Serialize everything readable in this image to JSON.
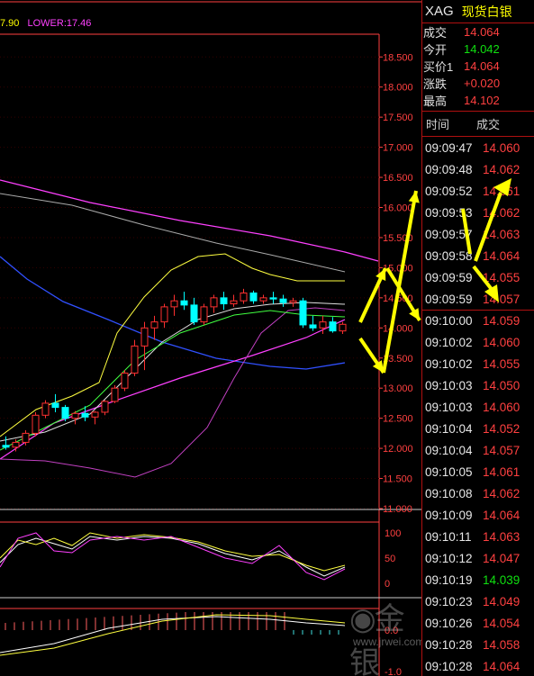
{
  "indicator": {
    "prefix": "7.90",
    "lower": "LOWER:17.46"
  },
  "symbol": {
    "code": "XAG",
    "name": "现货白银"
  },
  "quote": [
    {
      "label": "成交",
      "value": "14.064",
      "color": "red"
    },
    {
      "label": "今开",
      "value": "14.042",
      "color": "green"
    },
    {
      "label": "买价1",
      "value": "14.064",
      "color": "red"
    },
    {
      "label": "涨跌",
      "value": "+0.020",
      "color": "red"
    },
    {
      "label": "最高",
      "value": "14.102",
      "color": "red"
    }
  ],
  "tick_header": {
    "time": "时间",
    "price": "成交"
  },
  "ticks": [
    {
      "time": "09:09:47",
      "price": "14.060",
      "color": "red"
    },
    {
      "time": "09:09:48",
      "price": "14.062",
      "color": "red"
    },
    {
      "time": "09:09:52",
      "price": "14.061",
      "color": "red"
    },
    {
      "time": "09:09:53",
      "price": "14.062",
      "color": "red"
    },
    {
      "time": "09:09:57",
      "price": "14.063",
      "color": "red"
    },
    {
      "time": "09:09:58",
      "price": "14.064",
      "color": "red"
    },
    {
      "time": "09:09:59",
      "price": "14.055",
      "color": "red"
    },
    {
      "time": "09:09:59",
      "price": "14.057",
      "color": "red"
    },
    {
      "time": "09:10:00",
      "price": "14.059",
      "color": "red"
    },
    {
      "time": "09:10:02",
      "price": "14.060",
      "color": "red"
    },
    {
      "time": "09:10:02",
      "price": "14.055",
      "color": "red"
    },
    {
      "time": "09:10:03",
      "price": "14.050",
      "color": "red"
    },
    {
      "time": "09:10:03",
      "price": "14.060",
      "color": "red"
    },
    {
      "time": "09:10:04",
      "price": "14.052",
      "color": "red"
    },
    {
      "time": "09:10:04",
      "price": "14.057",
      "color": "red"
    },
    {
      "time": "09:10:05",
      "price": "14.061",
      "color": "red"
    },
    {
      "time": "09:10:08",
      "price": "14.062",
      "color": "red"
    },
    {
      "time": "09:10:09",
      "price": "14.064",
      "color": "red"
    },
    {
      "time": "09:10:11",
      "price": "14.063",
      "color": "red"
    },
    {
      "time": "09:10:12",
      "price": "14.047",
      "color": "red"
    },
    {
      "time": "09:10:19",
      "price": "14.039",
      "color": "green"
    },
    {
      "time": "09:10:23",
      "price": "14.049",
      "color": "red"
    },
    {
      "time": "09:10:26",
      "price": "14.054",
      "color": "red"
    },
    {
      "time": "09:10:28",
      "price": "14.058",
      "color": "red"
    },
    {
      "time": "09:10:28",
      "price": "14.064",
      "color": "red"
    }
  ],
  "price_axis": [
    "18.500",
    "18.000",
    "17.500",
    "17.000",
    "16.500",
    "16.000",
    "15.500",
    "15.000",
    "14.500",
    "14.000",
    "13.500",
    "13.000",
    "12.500",
    "12.000",
    "11.500",
    "11.000"
  ],
  "kdj_axis": [
    "100",
    "50",
    "0"
  ],
  "macd_axis": [
    "0.0",
    "-1.0"
  ],
  "watermark": {
    "logo": "金银圈",
    "url": "www.jrwei.com"
  },
  "colors": {
    "red": "#ff4040",
    "green": "#10e010",
    "grid": "#b01010",
    "yellow": "#ffff00",
    "magenta": "#ff40ff"
  },
  "candles": [
    {
      "o": 12.05,
      "h": 12.2,
      "l": 11.98,
      "c": 12.02
    },
    {
      "o": 12.02,
      "h": 12.15,
      "l": 11.95,
      "c": 12.1
    },
    {
      "o": 12.1,
      "h": 12.3,
      "l": 12.05,
      "c": 12.25
    },
    {
      "o": 12.25,
      "h": 12.6,
      "l": 12.2,
      "c": 12.55
    },
    {
      "o": 12.55,
      "h": 12.8,
      "l": 12.5,
      "c": 12.75
    },
    {
      "o": 12.75,
      "h": 12.9,
      "l": 12.6,
      "c": 12.68
    },
    {
      "o": 12.68,
      "h": 12.72,
      "l": 12.45,
      "c": 12.5
    },
    {
      "o": 12.5,
      "h": 12.62,
      "l": 12.4,
      "c": 12.58
    },
    {
      "o": 12.58,
      "h": 12.7,
      "l": 12.45,
      "c": 12.52
    },
    {
      "o": 12.52,
      "h": 12.62,
      "l": 12.4,
      "c": 12.6
    },
    {
      "o": 12.6,
      "h": 12.8,
      "l": 12.55,
      "c": 12.78
    },
    {
      "o": 12.78,
      "h": 13.05,
      "l": 12.75,
      "c": 13.0
    },
    {
      "o": 13.0,
      "h": 13.3,
      "l": 12.95,
      "c": 13.25
    },
    {
      "o": 13.25,
      "h": 13.8,
      "l": 13.2,
      "c": 13.7
    },
    {
      "o": 13.7,
      "h": 14.1,
      "l": 13.3,
      "c": 14.0
    },
    {
      "o": 14.0,
      "h": 14.2,
      "l": 13.8,
      "c": 14.1
    },
    {
      "o": 14.1,
      "h": 14.4,
      "l": 14.0,
      "c": 14.35
    },
    {
      "o": 14.35,
      "h": 14.55,
      "l": 14.2,
      "c": 14.45
    },
    {
      "o": 14.45,
      "h": 14.6,
      "l": 14.3,
      "c": 14.38
    },
    {
      "o": 14.38,
      "h": 14.5,
      "l": 14.05,
      "c": 14.1
    },
    {
      "o": 14.1,
      "h": 14.4,
      "l": 14.05,
      "c": 14.35
    },
    {
      "o": 14.35,
      "h": 14.55,
      "l": 14.25,
      "c": 14.5
    },
    {
      "o": 14.5,
      "h": 14.6,
      "l": 14.3,
      "c": 14.4
    },
    {
      "o": 14.4,
      "h": 14.55,
      "l": 14.35,
      "c": 14.45
    },
    {
      "o": 14.45,
      "h": 14.65,
      "l": 14.4,
      "c": 14.58
    },
    {
      "o": 14.58,
      "h": 14.62,
      "l": 14.4,
      "c": 14.45
    },
    {
      "o": 14.45,
      "h": 14.55,
      "l": 14.4,
      "c": 14.5
    },
    {
      "o": 14.5,
      "h": 14.6,
      "l": 14.4,
      "c": 14.48
    },
    {
      "o": 14.48,
      "h": 14.55,
      "l": 14.35,
      "c": 14.42
    },
    {
      "o": 14.42,
      "h": 14.5,
      "l": 14.35,
      "c": 14.45
    },
    {
      "o": 14.45,
      "h": 14.5,
      "l": 14.0,
      "c": 14.05
    },
    {
      "o": 14.05,
      "h": 14.2,
      "l": 13.95,
      "c": 14.0
    },
    {
      "o": 14.0,
      "h": 14.2,
      "l": 13.9,
      "c": 14.1
    },
    {
      "o": 14.1,
      "h": 14.18,
      "l": 13.92,
      "c": 13.95
    },
    {
      "o": 13.95,
      "h": 14.1,
      "l": 13.9,
      "c": 14.06
    }
  ]
}
